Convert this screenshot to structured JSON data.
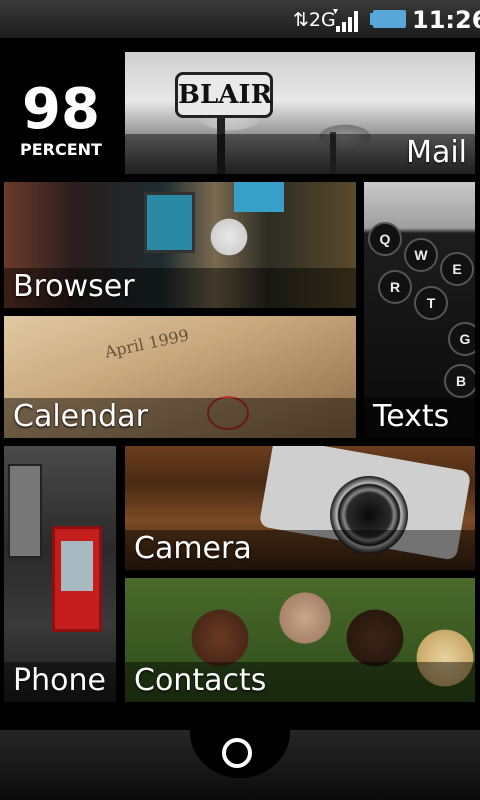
{
  "status_bar": {
    "network": "2G",
    "time": "11:26"
  },
  "battery_widget": {
    "value": "98",
    "unit": "PERCENT"
  },
  "tiles": {
    "mail": {
      "label": "Mail",
      "image_text": "BLAIR"
    },
    "browser": {
      "label": "Browser"
    },
    "texts": {
      "label": "Texts"
    },
    "calendar": {
      "label": "Calendar",
      "image_text": "April 1999"
    },
    "phone": {
      "label": "Phone"
    },
    "camera": {
      "label": "Camera"
    },
    "contacts": {
      "label": "Contacts"
    }
  },
  "texts_keys": [
    "Q",
    "W",
    "E",
    "R",
    "T",
    "G",
    "B"
  ],
  "colors": {
    "background": "#000000",
    "accent": "#ffffff",
    "phone_booth": "#c41e1e"
  }
}
